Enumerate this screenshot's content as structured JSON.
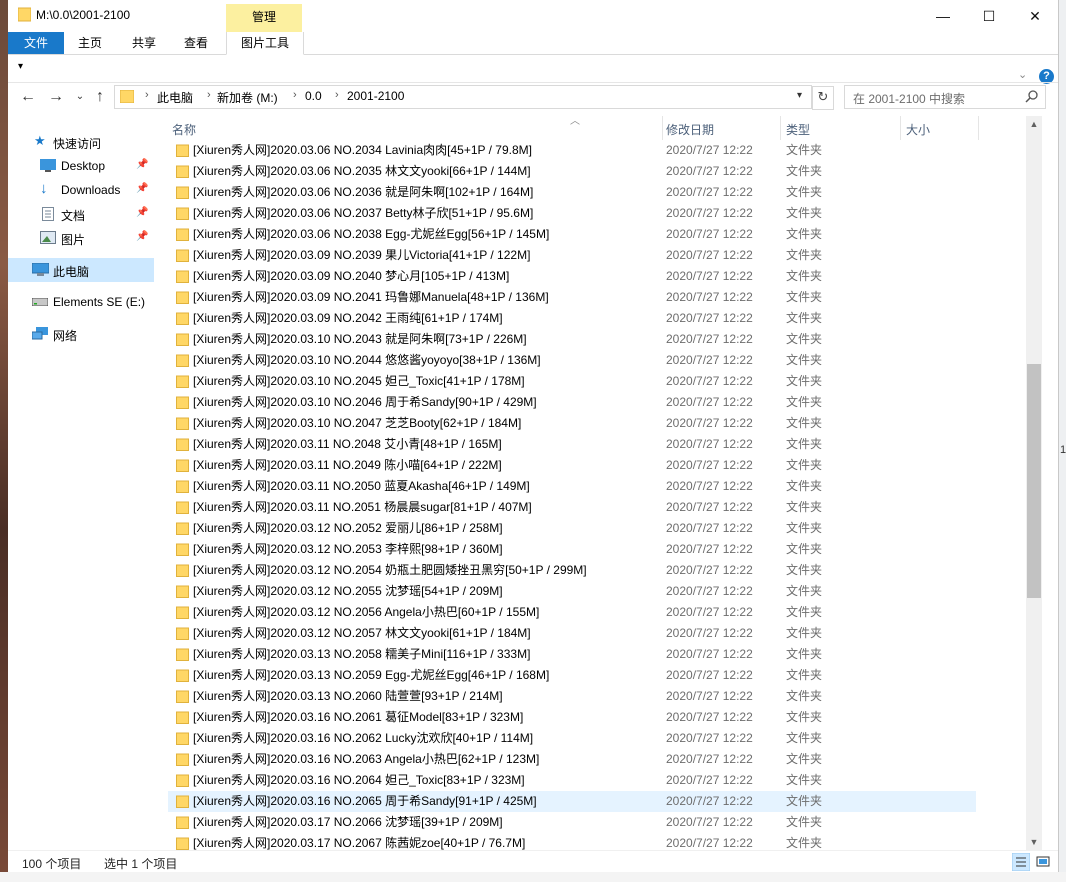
{
  "window": {
    "title": "M:\\0.0\\2001-2100",
    "context_tab": "管理",
    "controls": {
      "minimize": "—",
      "maximize": "☐",
      "close": "✕"
    }
  },
  "ribbon": {
    "tabs": [
      "文件",
      "主页",
      "共享",
      "查看",
      "图片工具"
    ],
    "help": "?"
  },
  "address": {
    "crumbs": [
      "此电脑",
      "新加卷 (M:)",
      "0.0",
      "2001-2100"
    ],
    "search_placeholder": "在 2001-2100 中搜索"
  },
  "sidebar": {
    "items": [
      {
        "label": "快速访问",
        "icon": "star-icon",
        "pinned": false
      },
      {
        "label": "Desktop",
        "icon": "desktop-icon",
        "pinned": true
      },
      {
        "label": "Downloads",
        "icon": "download-icon",
        "pinned": true
      },
      {
        "label": "文档",
        "icon": "document-icon",
        "pinned": true
      },
      {
        "label": "图片",
        "icon": "pictures-icon",
        "pinned": true
      },
      {
        "label": "此电脑",
        "icon": "computer-icon",
        "pinned": false
      },
      {
        "label": "Elements SE (E:)",
        "icon": "drive-icon",
        "pinned": false
      },
      {
        "label": "网络",
        "icon": "network-icon",
        "pinned": false
      }
    ]
  },
  "columns": {
    "name": "名称",
    "date": "修改日期",
    "type": "类型",
    "size": "大小"
  },
  "files": [
    {
      "name": "[Xiuren秀人网]2020.03.06 NO.2034 Lavinia肉肉[45+1P / 79.8M]",
      "date": "2020/7/27 12:22",
      "type": "文件夹"
    },
    {
      "name": "[Xiuren秀人网]2020.03.06 NO.2035 林文文yooki[66+1P / 144M]",
      "date": "2020/7/27 12:22",
      "type": "文件夹"
    },
    {
      "name": "[Xiuren秀人网]2020.03.06 NO.2036 就是阿朱啊[102+1P / 164M]",
      "date": "2020/7/27 12:22",
      "type": "文件夹"
    },
    {
      "name": "[Xiuren秀人网]2020.03.06 NO.2037 Betty林子欣[51+1P / 95.6M]",
      "date": "2020/7/27 12:22",
      "type": "文件夹"
    },
    {
      "name": "[Xiuren秀人网]2020.03.06 NO.2038 Egg-尤妮丝Egg[56+1P / 145M]",
      "date": "2020/7/27 12:22",
      "type": "文件夹"
    },
    {
      "name": "[Xiuren秀人网]2020.03.09 NO.2039 果儿Victoria[41+1P / 122M]",
      "date": "2020/7/27 12:22",
      "type": "文件夹"
    },
    {
      "name": "[Xiuren秀人网]2020.03.09 NO.2040 梦心月[105+1P / 413M]",
      "date": "2020/7/27 12:22",
      "type": "文件夹"
    },
    {
      "name": "[Xiuren秀人网]2020.03.09 NO.2041 玛鲁娜Manuela[48+1P / 136M]",
      "date": "2020/7/27 12:22",
      "type": "文件夹"
    },
    {
      "name": "[Xiuren秀人网]2020.03.09 NO.2042 王雨纯[61+1P / 174M]",
      "date": "2020/7/27 12:22",
      "type": "文件夹"
    },
    {
      "name": "[Xiuren秀人网]2020.03.10 NO.2043 就是阿朱啊[73+1P / 226M]",
      "date": "2020/7/27 12:22",
      "type": "文件夹"
    },
    {
      "name": "[Xiuren秀人网]2020.03.10 NO.2044 悠悠酱yoyoyo[38+1P / 136M]",
      "date": "2020/7/27 12:22",
      "type": "文件夹"
    },
    {
      "name": "[Xiuren秀人网]2020.03.10 NO.2045 妲己_Toxic[41+1P / 178M]",
      "date": "2020/7/27 12:22",
      "type": "文件夹"
    },
    {
      "name": "[Xiuren秀人网]2020.03.10 NO.2046 周于希Sandy[90+1P / 429M]",
      "date": "2020/7/27 12:22",
      "type": "文件夹"
    },
    {
      "name": "[Xiuren秀人网]2020.03.10 NO.2047 芝芝Booty[62+1P / 184M]",
      "date": "2020/7/27 12:22",
      "type": "文件夹"
    },
    {
      "name": "[Xiuren秀人网]2020.03.11 NO.2048 艾小青[48+1P / 165M]",
      "date": "2020/7/27 12:22",
      "type": "文件夹"
    },
    {
      "name": "[Xiuren秀人网]2020.03.11 NO.2049 陈小喵[64+1P / 222M]",
      "date": "2020/7/27 12:22",
      "type": "文件夹"
    },
    {
      "name": "[Xiuren秀人网]2020.03.11 NO.2050 蓝夏Akasha[46+1P / 149M]",
      "date": "2020/7/27 12:22",
      "type": "文件夹"
    },
    {
      "name": "[Xiuren秀人网]2020.03.11 NO.2051 杨晨晨sugar[81+1P / 407M]",
      "date": "2020/7/27 12:22",
      "type": "文件夹"
    },
    {
      "name": "[Xiuren秀人网]2020.03.12 NO.2052 爱丽儿[86+1P / 258M]",
      "date": "2020/7/27 12:22",
      "type": "文件夹"
    },
    {
      "name": "[Xiuren秀人网]2020.03.12 NO.2053 李梓熙[98+1P / 360M]",
      "date": "2020/7/27 12:22",
      "type": "文件夹"
    },
    {
      "name": "[Xiuren秀人网]2020.03.12 NO.2054 奶瓶土肥圆矮挫丑黑穷[50+1P / 299M]",
      "date": "2020/7/27 12:22",
      "type": "文件夹"
    },
    {
      "name": "[Xiuren秀人网]2020.03.12 NO.2055 沈梦瑶[54+1P / 209M]",
      "date": "2020/7/27 12:22",
      "type": "文件夹"
    },
    {
      "name": "[Xiuren秀人网]2020.03.12 NO.2056 Angela小热巴[60+1P / 155M]",
      "date": "2020/7/27 12:22",
      "type": "文件夹"
    },
    {
      "name": "[Xiuren秀人网]2020.03.12 NO.2057 林文文yooki[61+1P / 184M]",
      "date": "2020/7/27 12:22",
      "type": "文件夹"
    },
    {
      "name": "[Xiuren秀人网]2020.03.13 NO.2058 糯美子Mini[116+1P / 333M]",
      "date": "2020/7/27 12:22",
      "type": "文件夹"
    },
    {
      "name": "[Xiuren秀人网]2020.03.13 NO.2059 Egg-尤妮丝Egg[46+1P / 168M]",
      "date": "2020/7/27 12:22",
      "type": "文件夹"
    },
    {
      "name": "[Xiuren秀人网]2020.03.13 NO.2060 陆萱萱[93+1P / 214M]",
      "date": "2020/7/27 12:22",
      "type": "文件夹"
    },
    {
      "name": "[Xiuren秀人网]2020.03.16 NO.2061 葛征Model[83+1P / 323M]",
      "date": "2020/7/27 12:22",
      "type": "文件夹"
    },
    {
      "name": "[Xiuren秀人网]2020.03.16 NO.2062 Lucky沈欢欣[40+1P / 114M]",
      "date": "2020/7/27 12:22",
      "type": "文件夹"
    },
    {
      "name": "[Xiuren秀人网]2020.03.16 NO.2063 Angela小热巴[62+1P / 123M]",
      "date": "2020/7/27 12:22",
      "type": "文件夹"
    },
    {
      "name": "[Xiuren秀人网]2020.03.16 NO.2064 妲己_Toxic[83+1P / 323M]",
      "date": "2020/7/27 12:22",
      "type": "文件夹"
    },
    {
      "name": "[Xiuren秀人网]2020.03.16 NO.2065 周于希Sandy[91+1P / 425M]",
      "date": "2020/7/27 12:22",
      "type": "文件夹",
      "selected": true
    },
    {
      "name": "[Xiuren秀人网]2020.03.17 NO.2066 沈梦瑶[39+1P / 209M]",
      "date": "2020/7/27 12:22",
      "type": "文件夹"
    },
    {
      "name": "[Xiuren秀人网]2020.03.17 NO.2067 陈茜妮zoe[40+1P / 76.7M]",
      "date": "2020/7/27 12:22",
      "type": "文件夹"
    }
  ],
  "status": {
    "count": "100 个项目",
    "selected": "选中 1 个项目"
  },
  "colors": {
    "accent": "#1979ca",
    "folder": "#ffd766",
    "selection": "#e5f3ff",
    "nav_selection": "#cce8ff",
    "context_tab": "#fcf0a0"
  }
}
